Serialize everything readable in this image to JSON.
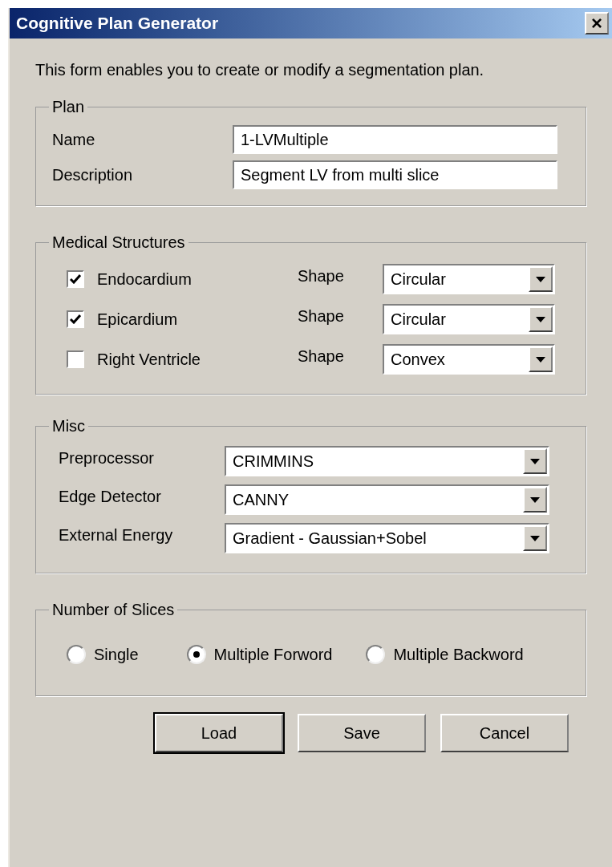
{
  "window": {
    "title": "Cognitive Plan Generator",
    "close": "×"
  },
  "intro": "This form enables you to create or modify a segmentation plan.",
  "plan": {
    "title": "Plan",
    "fields": [
      {
        "label": "Name",
        "value": "1-LVMultiple"
      },
      {
        "label": "Description",
        "value": "Segment LV from multi slice"
      }
    ]
  },
  "structures": {
    "title": "Medical Structures",
    "rows": [
      {
        "label": "Endocardium",
        "checked": true,
        "shape_label": "Shape",
        "shape": "Circular"
      },
      {
        "label": "Epicardium",
        "checked": true,
        "shape_label": "Shape",
        "shape": "Circular"
      },
      {
        "label": "Right Ventricle",
        "checked": false,
        "shape_label": "Shape",
        "shape": "Convex"
      }
    ]
  },
  "misc": {
    "title": "Misc",
    "rows": [
      {
        "label": "Preprocessor",
        "value": "CRIMMINS"
      },
      {
        "label": "Edge Detector",
        "value": "CANNY"
      },
      {
        "label": "External Energy",
        "value": "Gradient - Gaussian+Sobel"
      }
    ]
  },
  "slices": {
    "title": "Number of Slices",
    "options": [
      {
        "label": "Single",
        "selected": false
      },
      {
        "label": "Multiple Forword",
        "selected": true
      },
      {
        "label": "Multiple Backword",
        "selected": false
      }
    ]
  },
  "buttons": [
    {
      "label": "Load",
      "default": true
    },
    {
      "label": "Save",
      "default": false
    },
    {
      "label": "Cancel",
      "default": false
    }
  ]
}
